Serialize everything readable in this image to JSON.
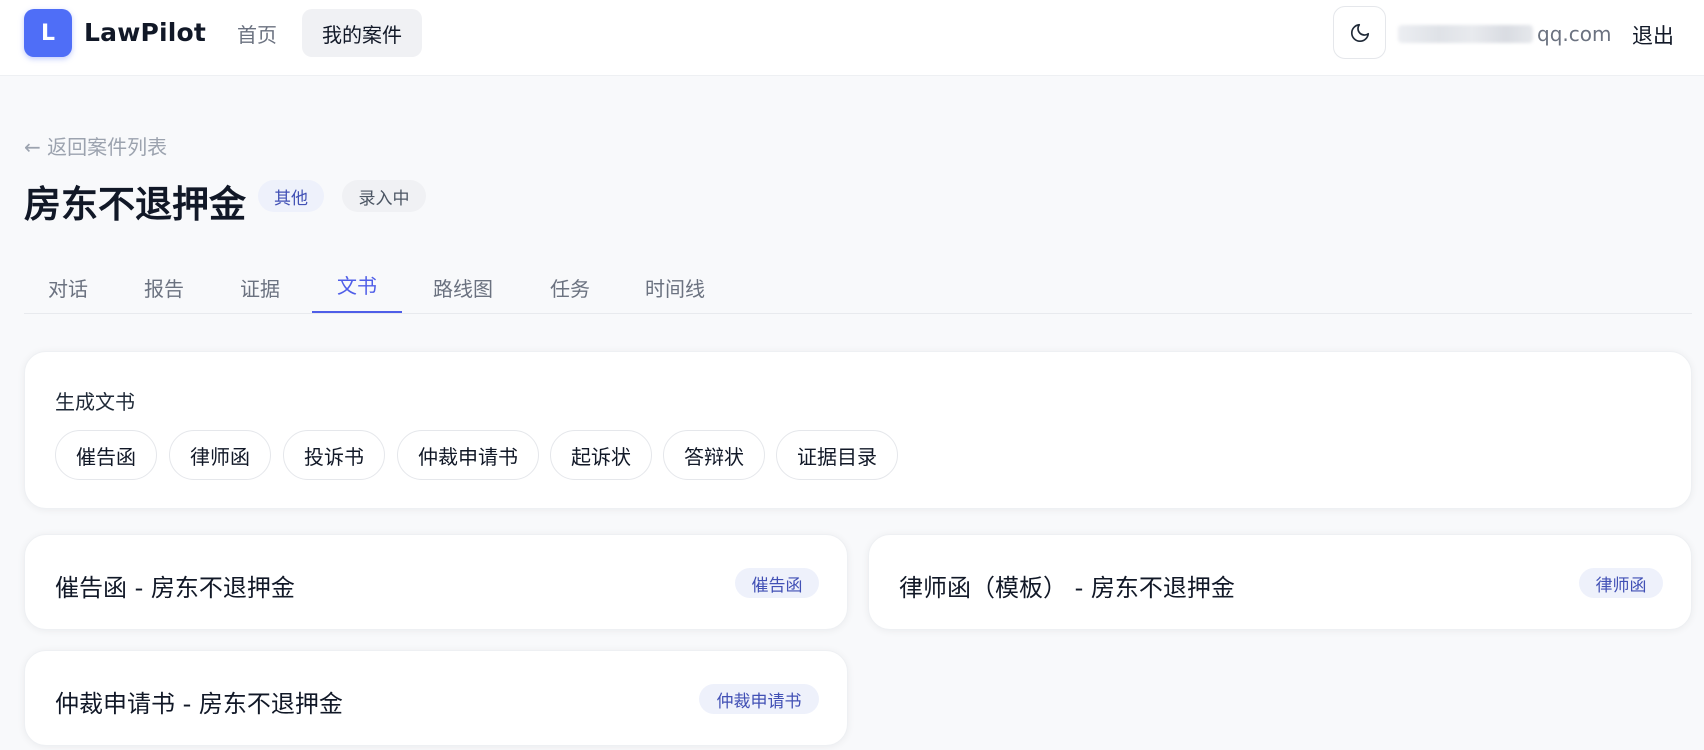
{
  "header": {
    "logo_letter": "L",
    "brand": "LawPilot",
    "nav": {
      "home": "首页",
      "cases": "我的案件"
    },
    "email_visible": "qq.com",
    "logout": "退出"
  },
  "case": {
    "back_link": "← 返回案件列表",
    "title": "房东不退押金",
    "type_badge": "其他",
    "status_badge": "录入中"
  },
  "tabs": [
    {
      "label": "对话",
      "active": false
    },
    {
      "label": "报告",
      "active": false
    },
    {
      "label": "证据",
      "active": false
    },
    {
      "label": "文书",
      "active": true
    },
    {
      "label": "路线图",
      "active": false
    },
    {
      "label": "任务",
      "active": false
    },
    {
      "label": "时间线",
      "active": false
    }
  ],
  "generate": {
    "title": "生成文书",
    "buttons": [
      "催告函",
      "律师函",
      "投诉书",
      "仲裁申请书",
      "起诉状",
      "答辩状",
      "证据目录"
    ]
  },
  "documents": [
    {
      "title": "催告函 - 房东不退押金",
      "badge": "催告函"
    },
    {
      "title": "律师函（模板） - 房东不退押金",
      "badge": "律师函"
    },
    {
      "title": "仲裁申请书 - 房东不退押金",
      "badge": "仲裁申请书"
    }
  ],
  "icons": {
    "theme_toggle": "moon-icon"
  },
  "colors": {
    "accent": "#4f5ee8",
    "logo_bg": "#4f6ef7",
    "badge_bg": "#eef1fb",
    "badge_text": "#4150b5"
  }
}
